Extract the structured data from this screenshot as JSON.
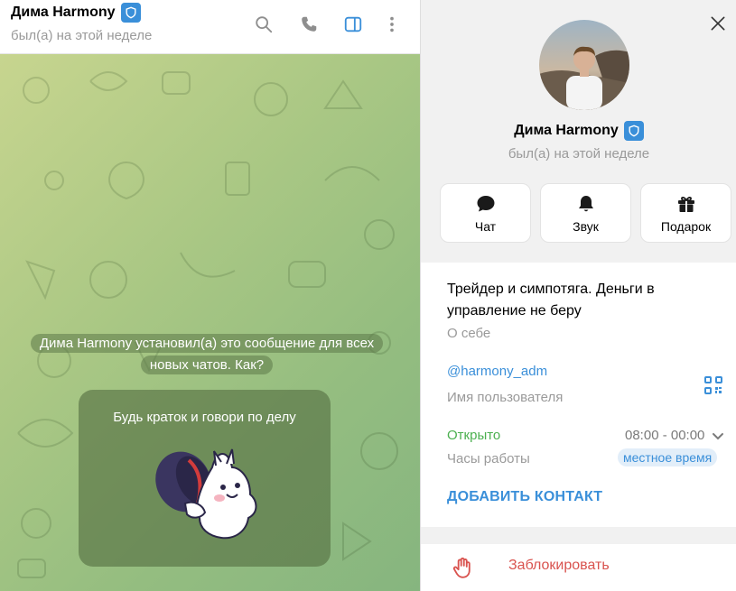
{
  "chat": {
    "title": "Дима Harmony",
    "status": "был(а) на этой неделе",
    "service_message": "Дима Harmony установил(а) это сообщение для всех новых чатов. Как?",
    "greeting_text": "Будь краток и говори по делу"
  },
  "profile": {
    "name": "Дима Harmony",
    "status": "был(а) на этой неделе",
    "actions": [
      {
        "label": "Чат",
        "icon": "chat-bubble-icon"
      },
      {
        "label": "Звук",
        "icon": "bell-icon"
      },
      {
        "label": "Подарок",
        "icon": "gift-icon"
      }
    ],
    "bio": "Трейдер и симпотяга. Деньги в управление не беру",
    "bio_label": "О себе",
    "username": "@harmony_adm",
    "username_label": "Имя пользователя",
    "open_status": "Открыто",
    "hours": "08:00 - 00:00",
    "hours_label": "Часы работы",
    "timezone_badge": "местное время",
    "add_contact": "ДОБАВИТЬ КОНТАКТ",
    "block": "Заблокировать"
  },
  "colors": {
    "accent": "#3a8fd9",
    "open_green": "#4cb050",
    "danger": "#d9534f"
  }
}
